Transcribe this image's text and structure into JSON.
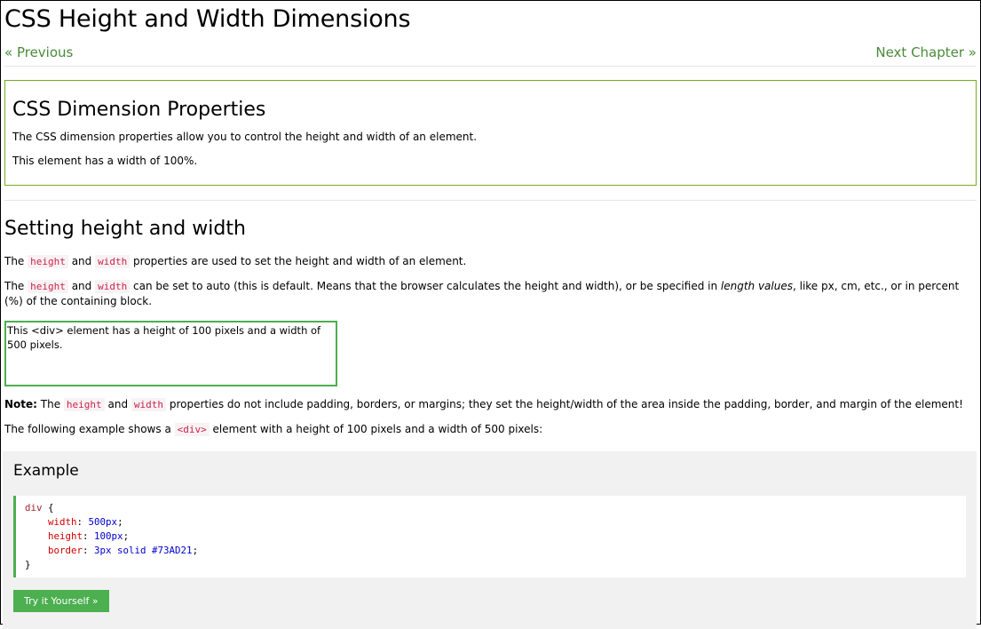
{
  "header": {
    "title": "CSS Height and Width Dimensions",
    "prev_label": "« Previous",
    "next_label": "Next Chapter »"
  },
  "intro_box": {
    "heading": "CSS Dimension Properties",
    "para1": "The CSS dimension properties allow you to control the height and width of an element.",
    "para2": "This element has a width of 100%."
  },
  "section": {
    "heading": "Setting height and width",
    "p1": {
      "pre": "The ",
      "code1": "height",
      "mid": " and ",
      "code2": "width",
      "post": " properties are used to set the height and width of an element."
    },
    "p2": {
      "pre": "The ",
      "code1": "height",
      "mid": " and ",
      "code2": "width",
      "post": " can be set to auto (this is default. Means that the browser calculates the height and width), or be specified in ",
      "em": "length values",
      "post2": ", like px, cm, etc., or in percent (%) of the containing block."
    },
    "demo_text": "This <div> element has a height of 100 pixels and a width of 500 pixels.",
    "note": {
      "label": "Note:",
      "pre": " The ",
      "code1": "height",
      "mid": " and ",
      "code2": "width",
      "post": " properties do not include padding, borders, or margins; they set the height/width of the area inside the padding, border, and margin of the element!"
    },
    "p3": {
      "pre": "The following example shows a ",
      "code": "<div>",
      "post": " element with a height of 100 pixels and a width of 500 pixels:"
    }
  },
  "example": {
    "heading": "Example",
    "code": {
      "selector": "div",
      "open": " {",
      "lines": [
        {
          "prop": "width",
          "value": "500px"
        },
        {
          "prop": "height",
          "value": "100px"
        },
        {
          "prop": "border",
          "value": "3px solid #73AD21"
        }
      ],
      "close": "}"
    },
    "try_label": "Try it Yourself »"
  },
  "colors": {
    "accent_green": "#4caf50",
    "border_green": "#73AD21",
    "link_green": "#4a8a3a"
  }
}
